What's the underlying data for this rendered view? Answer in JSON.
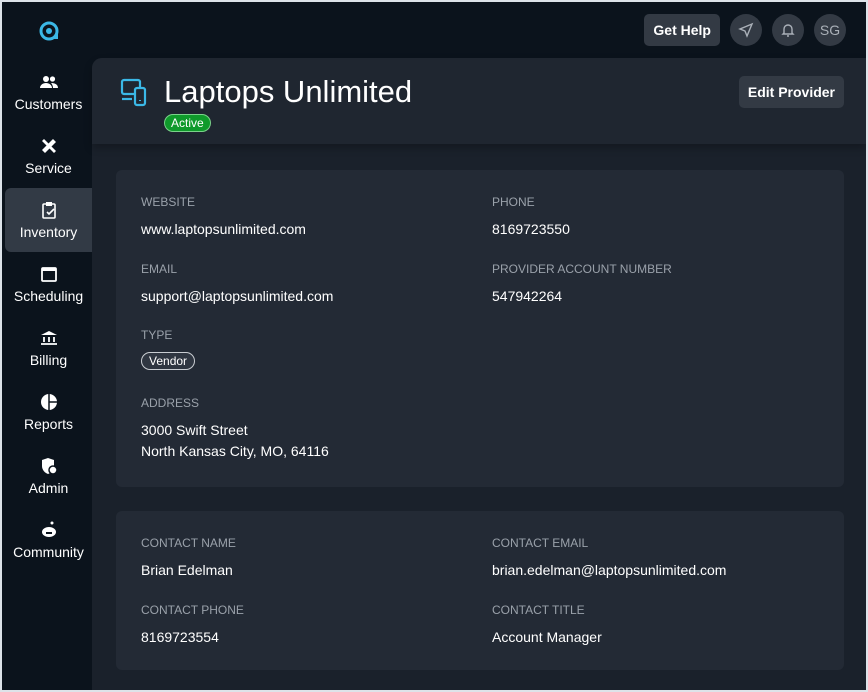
{
  "nav": [
    {
      "label": "Customers",
      "icon": "people-icon"
    },
    {
      "label": "Service",
      "icon": "tools-icon"
    },
    {
      "label": "Inventory",
      "icon": "clipboard-check-icon",
      "active": true
    },
    {
      "label": "Scheduling",
      "icon": "calendar-icon"
    },
    {
      "label": "Billing",
      "icon": "bank-icon"
    },
    {
      "label": "Reports",
      "icon": "pie-chart-icon"
    },
    {
      "label": "Admin",
      "icon": "shield-user-icon"
    },
    {
      "label": "Community",
      "icon": "community-icon"
    }
  ],
  "topbar": {
    "get_help": "Get Help",
    "avatar": "SG"
  },
  "provider": {
    "name": "Laptops Unlimited",
    "status": "Active",
    "edit": "Edit Provider"
  },
  "details": {
    "website_label": "WEBSITE",
    "website": "www.laptopsunlimited.com",
    "phone_label": "PHONE",
    "phone": "8169723550",
    "email_label": "EMAIL",
    "email": "support@laptopsunlimited.com",
    "account_label": "PROVIDER ACCOUNT NUMBER",
    "account": "547942264",
    "type_label": "TYPE",
    "type": "Vendor",
    "address_label": "ADDRESS",
    "address1": "3000 Swift Street",
    "address2": "North Kansas City, MO, 64116"
  },
  "contact": {
    "name_label": "CONTACT NAME",
    "name": "Brian Edelman",
    "email_label": "CONTACT EMAIL",
    "email": "brian.edelman@laptopsunlimited.com",
    "phone_label": "CONTACT PHONE",
    "phone": "8169723554",
    "title_label": "CONTACT TITLE",
    "title": "Account Manager"
  },
  "colors": {
    "accent": "#3bb8e6",
    "active": "#0f9a2b"
  }
}
